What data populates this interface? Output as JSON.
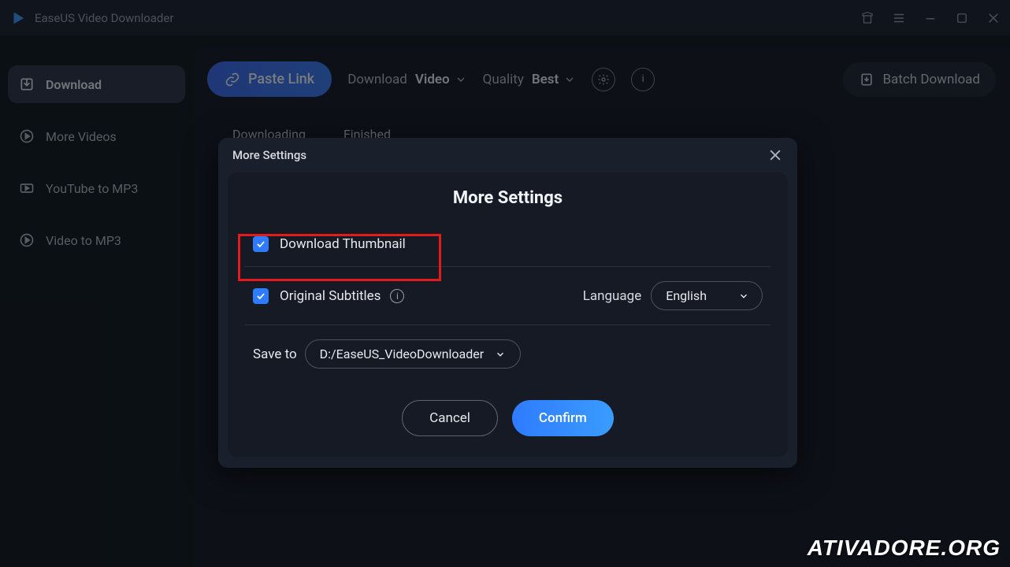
{
  "app": {
    "title": "EaseUS Video Downloader"
  },
  "sidebar": {
    "items": [
      {
        "label": "Download"
      },
      {
        "label": "More Videos"
      },
      {
        "label": "YouTube to MP3"
      },
      {
        "label": "Video to MP3"
      }
    ]
  },
  "toolbar": {
    "paste_label": "Paste Link",
    "download_prefix": "Download",
    "download_value": "Video",
    "quality_prefix": "Quality",
    "quality_value": "Best",
    "batch_label": "Batch Download"
  },
  "tabs": [
    {
      "label": "Downloading"
    },
    {
      "label": "Finished"
    }
  ],
  "modal": {
    "header_title": "More Settings",
    "body_title": "More Settings",
    "thumbnail_label": "Download Thumbnail",
    "subtitles_label": "Original Subtitles",
    "language_label": "Language",
    "language_value": "English",
    "save_to_label": "Save to",
    "save_to_value": "D:/EaseUS_VideoDownloader",
    "cancel_label": "Cancel",
    "confirm_label": "Confirm"
  },
  "watermark": "ATIVADORE.ORG"
}
